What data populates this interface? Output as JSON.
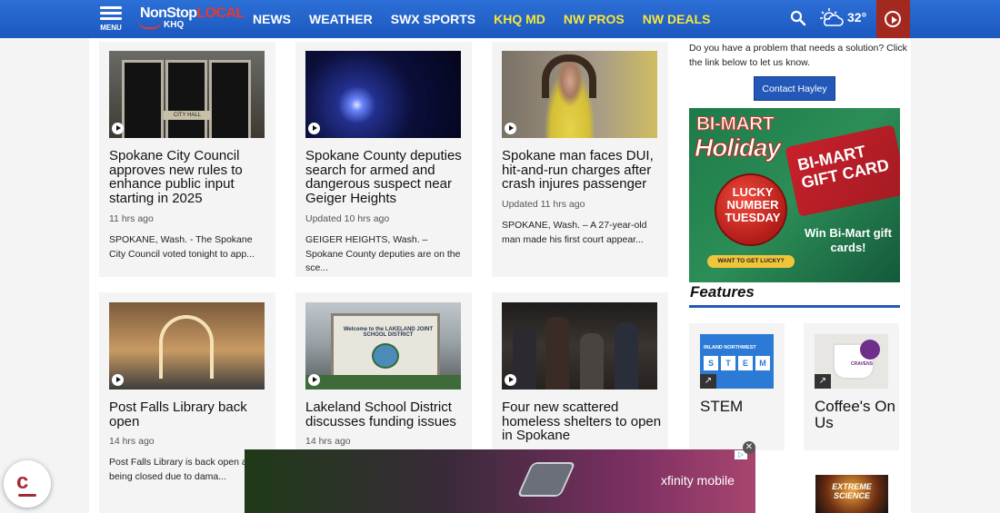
{
  "nav": {
    "menu_label": "MENU",
    "logo_text_1": "NonStop",
    "logo_text_2": "LOCAL",
    "logo_subtext": "KHQ",
    "links": [
      "NEWS",
      "WEATHER",
      "SWX SPORTS",
      "KHQ MD",
      "NW PROS",
      "NW DEALS"
    ],
    "temperature": "32°",
    "colors": {
      "bar": "#1f5ec8",
      "highlight_links": "#f7e63a",
      "live_button": "#a3281f"
    }
  },
  "articles": [
    {
      "headline": "Spokane City Council approves new rules to enhance public input starting in 2025",
      "time": "11 hrs ago",
      "summary": "SPOKANE, Wash. - The Spokane City Council voted tonight to app...",
      "thumb_label": "CITY HALL"
    },
    {
      "headline": "Spokane County deputies search for armed and dangerous suspect near Geiger Heights",
      "time": "Updated 10 hrs ago",
      "summary": "GEIGER HEIGHTS, Wash. – Spokane County deputies are on the sce..."
    },
    {
      "headline": "Spokane man faces DUI, hit-and-run charges after crash injures passenger",
      "time": "Updated 11 hrs ago",
      "summary": "SPOKANE, Wash. – A 27-year-old man made his first court appear..."
    },
    {
      "headline": "Post Falls Library back open",
      "time": "14 hrs ago",
      "summary": "Post Falls Library is back open af... being closed due to dama..."
    },
    {
      "headline": "Lakeland School District discusses funding issues",
      "time": "14 hrs ago",
      "summary": "",
      "thumb_label": "Welcome to the LAKELAND JOINT SCHOOL DISTRICT"
    },
    {
      "headline": "Four new scattered homeless shelters to open in Spokane",
      "time": "",
      "summary": ""
    }
  ],
  "sidebar": {
    "problem_text": "Do you have a problem that needs a solution? Click the link below to let us know.",
    "contact_button": "Contact Hayley",
    "ad": {
      "brand": "BI-MART",
      "headline": "Holiday",
      "ornament_text": "LUCKY NUMBER TUESDAY",
      "gift_card": "BI-MART GIFT CARD",
      "win_text": "Win Bi-Mart gift cards!",
      "cta": "WANT TO GET LUCKY?"
    },
    "features_title": "Features",
    "features": [
      {
        "title": "STEM",
        "thumb_label": "INLAND NORTHWEST",
        "letters": [
          "S",
          "T",
          "E",
          "M"
        ]
      },
      {
        "title": "Coffee's On Us",
        "thumb_label": "CRAVENS"
      }
    ],
    "next_feature_thumb_label": "EXTREME SCIENCE"
  },
  "bottom_ad": {
    "brand": "xfinity mobile"
  }
}
